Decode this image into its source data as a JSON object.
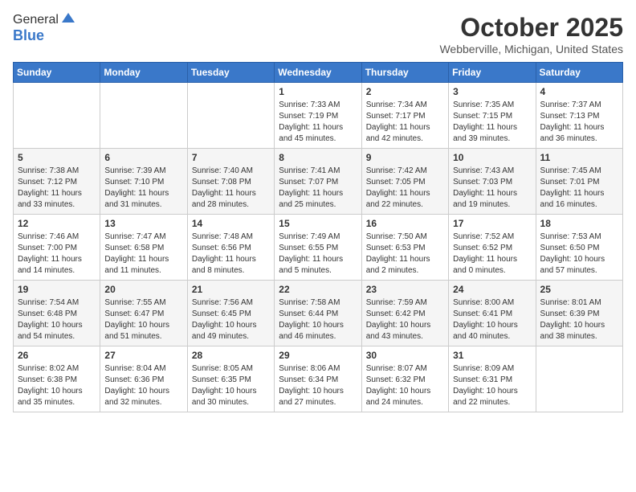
{
  "logo": {
    "general": "General",
    "blue": "Blue"
  },
  "title": "October 2025",
  "location": "Webberville, Michigan, United States",
  "weekdays": [
    "Sunday",
    "Monday",
    "Tuesday",
    "Wednesday",
    "Thursday",
    "Friday",
    "Saturday"
  ],
  "weeks": [
    [
      {
        "day": "",
        "info": ""
      },
      {
        "day": "",
        "info": ""
      },
      {
        "day": "",
        "info": ""
      },
      {
        "day": "1",
        "info": "Sunrise: 7:33 AM\nSunset: 7:19 PM\nDaylight: 11 hours\nand 45 minutes."
      },
      {
        "day": "2",
        "info": "Sunrise: 7:34 AM\nSunset: 7:17 PM\nDaylight: 11 hours\nand 42 minutes."
      },
      {
        "day": "3",
        "info": "Sunrise: 7:35 AM\nSunset: 7:15 PM\nDaylight: 11 hours\nand 39 minutes."
      },
      {
        "day": "4",
        "info": "Sunrise: 7:37 AM\nSunset: 7:13 PM\nDaylight: 11 hours\nand 36 minutes."
      }
    ],
    [
      {
        "day": "5",
        "info": "Sunrise: 7:38 AM\nSunset: 7:12 PM\nDaylight: 11 hours\nand 33 minutes."
      },
      {
        "day": "6",
        "info": "Sunrise: 7:39 AM\nSunset: 7:10 PM\nDaylight: 11 hours\nand 31 minutes."
      },
      {
        "day": "7",
        "info": "Sunrise: 7:40 AM\nSunset: 7:08 PM\nDaylight: 11 hours\nand 28 minutes."
      },
      {
        "day": "8",
        "info": "Sunrise: 7:41 AM\nSunset: 7:07 PM\nDaylight: 11 hours\nand 25 minutes."
      },
      {
        "day": "9",
        "info": "Sunrise: 7:42 AM\nSunset: 7:05 PM\nDaylight: 11 hours\nand 22 minutes."
      },
      {
        "day": "10",
        "info": "Sunrise: 7:43 AM\nSunset: 7:03 PM\nDaylight: 11 hours\nand 19 minutes."
      },
      {
        "day": "11",
        "info": "Sunrise: 7:45 AM\nSunset: 7:01 PM\nDaylight: 11 hours\nand 16 minutes."
      }
    ],
    [
      {
        "day": "12",
        "info": "Sunrise: 7:46 AM\nSunset: 7:00 PM\nDaylight: 11 hours\nand 14 minutes."
      },
      {
        "day": "13",
        "info": "Sunrise: 7:47 AM\nSunset: 6:58 PM\nDaylight: 11 hours\nand 11 minutes."
      },
      {
        "day": "14",
        "info": "Sunrise: 7:48 AM\nSunset: 6:56 PM\nDaylight: 11 hours\nand 8 minutes."
      },
      {
        "day": "15",
        "info": "Sunrise: 7:49 AM\nSunset: 6:55 PM\nDaylight: 11 hours\nand 5 minutes."
      },
      {
        "day": "16",
        "info": "Sunrise: 7:50 AM\nSunset: 6:53 PM\nDaylight: 11 hours\nand 2 minutes."
      },
      {
        "day": "17",
        "info": "Sunrise: 7:52 AM\nSunset: 6:52 PM\nDaylight: 11 hours\nand 0 minutes."
      },
      {
        "day": "18",
        "info": "Sunrise: 7:53 AM\nSunset: 6:50 PM\nDaylight: 10 hours\nand 57 minutes."
      }
    ],
    [
      {
        "day": "19",
        "info": "Sunrise: 7:54 AM\nSunset: 6:48 PM\nDaylight: 10 hours\nand 54 minutes."
      },
      {
        "day": "20",
        "info": "Sunrise: 7:55 AM\nSunset: 6:47 PM\nDaylight: 10 hours\nand 51 minutes."
      },
      {
        "day": "21",
        "info": "Sunrise: 7:56 AM\nSunset: 6:45 PM\nDaylight: 10 hours\nand 49 minutes."
      },
      {
        "day": "22",
        "info": "Sunrise: 7:58 AM\nSunset: 6:44 PM\nDaylight: 10 hours\nand 46 minutes."
      },
      {
        "day": "23",
        "info": "Sunrise: 7:59 AM\nSunset: 6:42 PM\nDaylight: 10 hours\nand 43 minutes."
      },
      {
        "day": "24",
        "info": "Sunrise: 8:00 AM\nSunset: 6:41 PM\nDaylight: 10 hours\nand 40 minutes."
      },
      {
        "day": "25",
        "info": "Sunrise: 8:01 AM\nSunset: 6:39 PM\nDaylight: 10 hours\nand 38 minutes."
      }
    ],
    [
      {
        "day": "26",
        "info": "Sunrise: 8:02 AM\nSunset: 6:38 PM\nDaylight: 10 hours\nand 35 minutes."
      },
      {
        "day": "27",
        "info": "Sunrise: 8:04 AM\nSunset: 6:36 PM\nDaylight: 10 hours\nand 32 minutes."
      },
      {
        "day": "28",
        "info": "Sunrise: 8:05 AM\nSunset: 6:35 PM\nDaylight: 10 hours\nand 30 minutes."
      },
      {
        "day": "29",
        "info": "Sunrise: 8:06 AM\nSunset: 6:34 PM\nDaylight: 10 hours\nand 27 minutes."
      },
      {
        "day": "30",
        "info": "Sunrise: 8:07 AM\nSunset: 6:32 PM\nDaylight: 10 hours\nand 24 minutes."
      },
      {
        "day": "31",
        "info": "Sunrise: 8:09 AM\nSunset: 6:31 PM\nDaylight: 10 hours\nand 22 minutes."
      },
      {
        "day": "",
        "info": ""
      }
    ]
  ]
}
